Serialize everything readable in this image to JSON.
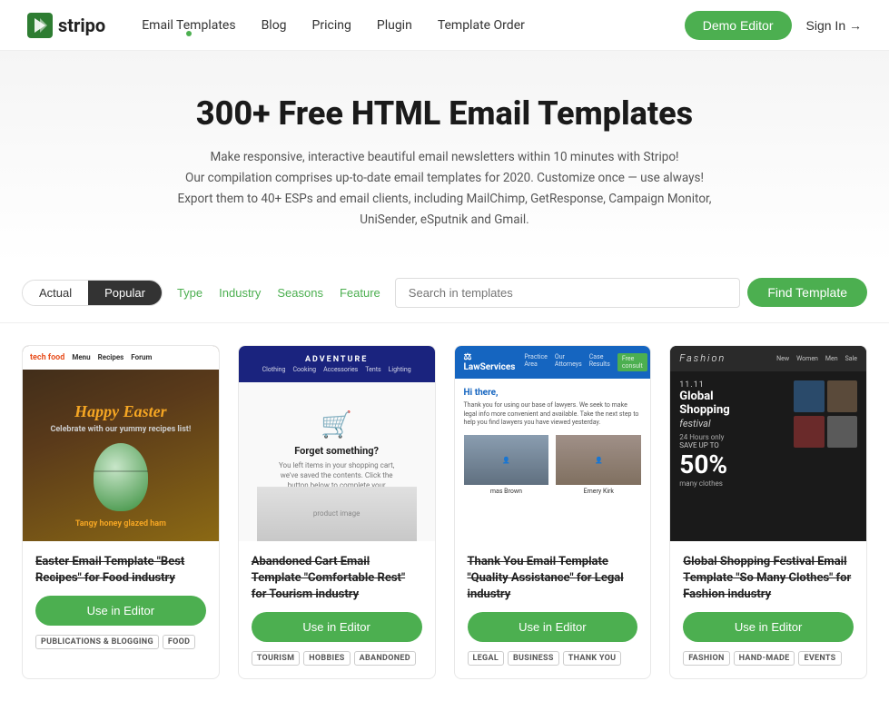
{
  "site": {
    "logo_text": "stripo",
    "logo_icon": "⚡"
  },
  "navbar": {
    "links": [
      {
        "label": "Email Templates",
        "active": true
      },
      {
        "label": "Blog",
        "active": false
      },
      {
        "label": "Pricing",
        "active": false
      },
      {
        "label": "Plugin",
        "active": false
      },
      {
        "label": "Template Order",
        "active": false
      }
    ],
    "demo_button": "Demo Editor",
    "signin_button": "Sign In →"
  },
  "hero": {
    "title": "300+ Free HTML Email Templates",
    "line1": "Make responsive, interactive beautiful email newsletters within 10 minutes with Stripo!",
    "line2": "Our compilation comprises up-to-date email templates for 2020. Customize once — use always!",
    "line3": "Export them to 40+ ESPs and email clients, including MailChimp, GetResponse, Campaign Monitor, UniSender, eSputnik and Gmail."
  },
  "filter": {
    "tab_actual": "Actual",
    "tab_popular": "Popular",
    "link_type": "Type",
    "link_industry": "Industry",
    "link_seasons": "Seasons",
    "link_feature": "Feature",
    "search_placeholder": "Search in templates",
    "find_button": "Find Template"
  },
  "templates": [
    {
      "id": "easter",
      "title": "Easter Email Template \"Best Recipes\" for Food industry",
      "use_button": "Use in Editor",
      "tags": [
        "PUBLICATIONS & BLOGGING",
        "FOOD"
      ],
      "preview_type": "easter"
    },
    {
      "id": "cart",
      "title": "Abandoned Cart Email Template \"Comfortable Rest\" for Tourism industry",
      "use_button": "Use in Editor",
      "tags": [
        "TOURISM",
        "HOBBIES",
        "ABANDONED"
      ],
      "preview_type": "cart"
    },
    {
      "id": "legal",
      "title": "Thank You Email Template \"Quality Assistance\" for Legal industry",
      "use_button": "Use in Editor",
      "tags": [
        "LEGAL",
        "BUSINESS",
        "THANK YOU"
      ],
      "preview_type": "legal"
    },
    {
      "id": "fashion",
      "title": "Global Shopping Festival Email Template \"So Many Clothes\" for Fashion industry",
      "use_button": "Use in Editor",
      "tags": [
        "FASHION",
        "HAND-MADE",
        "EVENTS"
      ],
      "preview_type": "fashion"
    }
  ]
}
